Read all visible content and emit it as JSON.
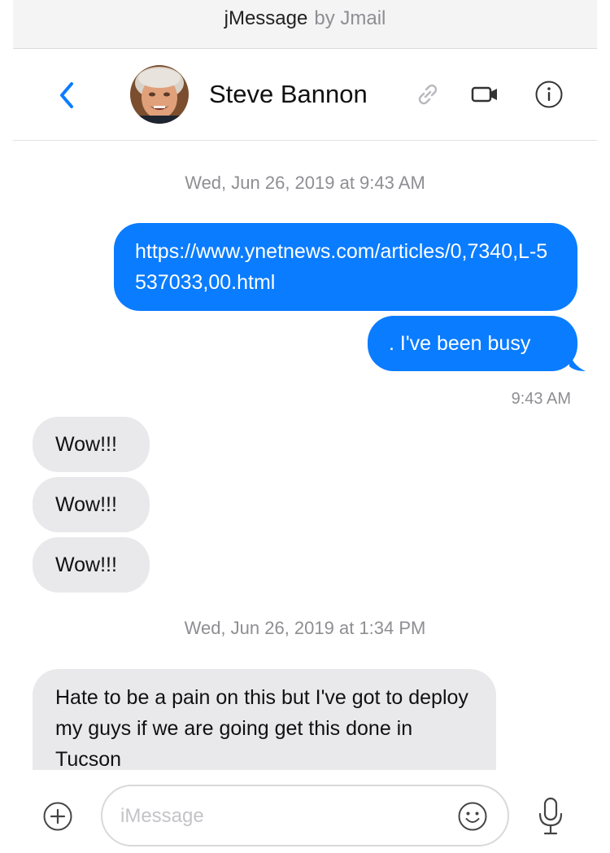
{
  "app": {
    "name": "jMessage",
    "byline": "by Jmail"
  },
  "header": {
    "contact_name": "Steve Bannon",
    "icons": {
      "back": "chevron-left-icon",
      "link": "link-icon",
      "video": "video-camera-icon",
      "info": "info-icon"
    }
  },
  "messages": {
    "stamp1": "Wed, Jun 26, 2019 at 9:43 AM",
    "out1": "https://www.ynetnews.com/articles/0,7340,L-5537033,00.html",
    "out2": ". I've been busy",
    "time1": "9:43 AM",
    "in1": "Wow!!!",
    "in2": "Wow!!!",
    "in3": "Wow!!!",
    "stamp2": "Wed, Jun 26, 2019 at 1:34 PM",
    "in4": "Hate to be a pain on this but I've got to deploy my guys if we are going get this done in Tucson"
  },
  "compose": {
    "placeholder": "iMessage"
  },
  "colors": {
    "outgoing": "#0a7cff",
    "incoming": "#e9e9eb",
    "accent": "#0a7cff",
    "muted": "#8e8e93"
  }
}
